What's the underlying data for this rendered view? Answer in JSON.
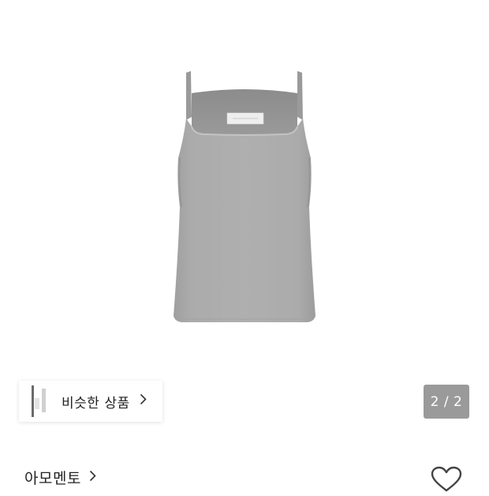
{
  "similar_products": {
    "label": "비슷한 상품",
    "chevron_icon": "chevron-right-icon"
  },
  "gallery": {
    "page_indicator": "2 / 2",
    "current_page": 2,
    "total_pages": 2
  },
  "brand": {
    "name": "아모멘토",
    "chevron_icon": "chevron-right-icon"
  },
  "like": {
    "icon": "heart-outline-icon"
  },
  "colors": {
    "product_gray": "#a9a9a9",
    "indicator_bg": "#9a9a9a",
    "text": "#222222"
  }
}
